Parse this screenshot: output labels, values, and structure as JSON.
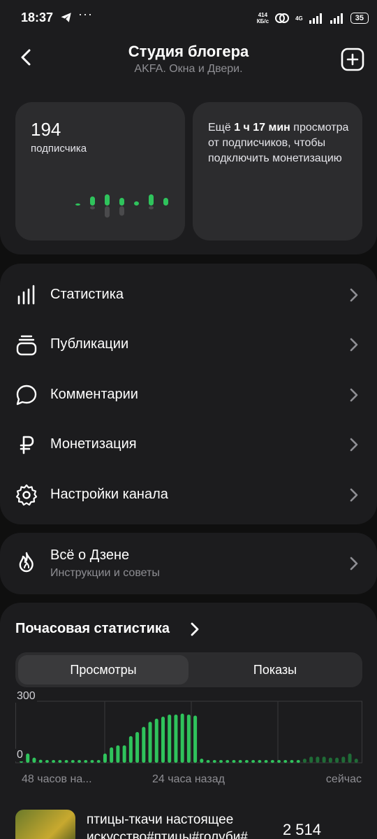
{
  "status_bar": {
    "time": "18:37",
    "dots": "···",
    "speed_top": "414",
    "speed_bottom": "КБ/с",
    "network": "4G",
    "battery": "35"
  },
  "header": {
    "title": "Студия блогера",
    "subtitle": "AKFA. Окна и Двери."
  },
  "subscribers": {
    "count": "194",
    "label": "подписчика",
    "trend": [
      {
        "up": 0.1,
        "down": 0.0
      },
      {
        "up": 0.65,
        "down": 0.25
      },
      {
        "up": 0.8,
        "down": 0.9
      },
      {
        "up": 0.55,
        "down": 0.75
      },
      {
        "up": 0.3,
        "down": 0.0
      },
      {
        "up": 0.8,
        "down": 0.25
      },
      {
        "up": 0.55,
        "down": 0.0
      }
    ]
  },
  "monetization_card": {
    "prefix": "Ещё ",
    "time": "1 ч 17 мин",
    "text": " просмотра от подписчиков, чтобы подключить монетизацию"
  },
  "menu": [
    {
      "label": "Статистика",
      "icon": "bar-chart-icon"
    },
    {
      "label": "Публикации",
      "icon": "publications-icon"
    },
    {
      "label": "Комментарии",
      "icon": "comment-icon"
    },
    {
      "label": "Монетизация",
      "icon": "ruble-icon"
    },
    {
      "label": "Настройки канала",
      "icon": "gear-icon"
    }
  ],
  "zen": {
    "title": "Всё о Дзене",
    "subtitle": "Инструкции и советы",
    "icon": "flame-icon"
  },
  "hourly": {
    "title": "Почасовая статистика",
    "tabs": [
      "Просмотры",
      "Показы"
    ],
    "active_tab": "Просмотры",
    "y_max_label": "300",
    "y_min_label": "0",
    "x_labels": [
      "48 часов на...",
      "24 часа назад",
      "сейчас"
    ]
  },
  "chart_data": {
    "type": "bar",
    "title": "",
    "ylim": [
      0,
      300
    ],
    "values": [
      15,
      45,
      25,
      15,
      10,
      10,
      10,
      10,
      10,
      10,
      10,
      10,
      10,
      45,
      75,
      85,
      85,
      130,
      150,
      175,
      200,
      215,
      225,
      235,
      235,
      240,
      235,
      230,
      20,
      10,
      10,
      10,
      10,
      10,
      10,
      10,
      10,
      10,
      10,
      10,
      10,
      10,
      10,
      10,
      20,
      30,
      30,
      30,
      25,
      25,
      30,
      45,
      20
    ],
    "colors": {
      "recent": "#2fc35c",
      "older": "#1f6b36"
    }
  },
  "publication": {
    "title": "птицы-ткачи настоящее искусство#птицы#голуби#",
    "views": "2 514"
  },
  "colors": {
    "accent_green": "#2fc35c",
    "background": "#1c1c1e",
    "card": "#2c2c2e"
  }
}
